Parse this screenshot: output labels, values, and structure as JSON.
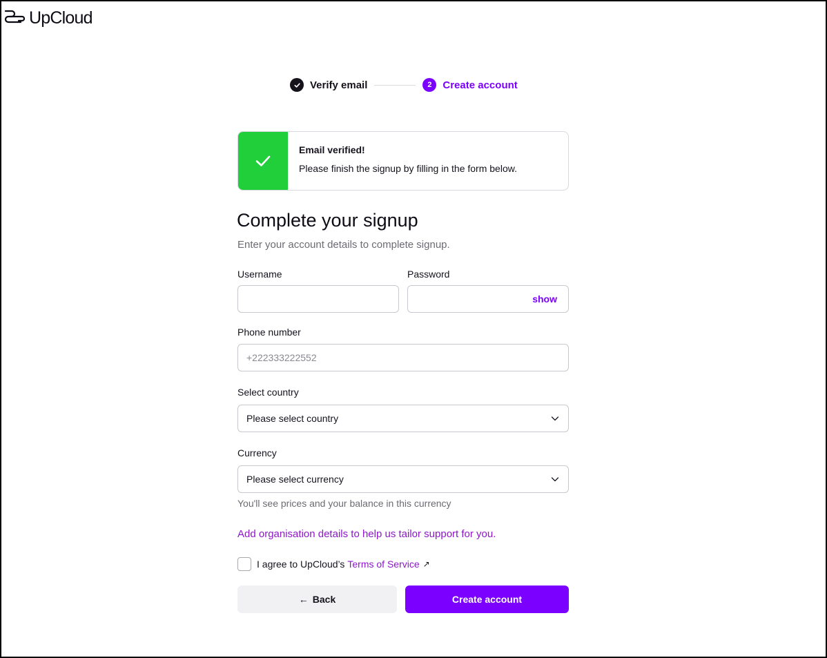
{
  "brand": {
    "name": "UpCloud",
    "accent": "#7b00ff",
    "success": "#21cf3a",
    "link": "#8d16c9"
  },
  "stepper": {
    "steps": [
      {
        "label": "Verify email",
        "status": "done",
        "icon": "check-icon"
      },
      {
        "label": "Create account",
        "status": "active",
        "number": "2"
      }
    ]
  },
  "alert": {
    "title": "Email verified!",
    "text": "Please finish the signup by filling in the form below.",
    "icon": "check-icon"
  },
  "form": {
    "title": "Complete your signup",
    "subtitle": "Enter your account details to complete signup.",
    "username": {
      "label": "Username",
      "value": "",
      "placeholder": ""
    },
    "password": {
      "label": "Password",
      "value": "",
      "placeholder": "",
      "toggle_label": "show"
    },
    "phone": {
      "label": "Phone number",
      "value": "",
      "placeholder": "+222333222552"
    },
    "country": {
      "label": "Select country",
      "selected": "Please select country",
      "icon": "chevron-down-icon"
    },
    "currency": {
      "label": "Currency",
      "selected": "Please select currency",
      "hint": "You'll see prices and your balance in this currency",
      "icon": "chevron-down-icon"
    },
    "org_link": "Add organisation details to help us tailor support for you.",
    "agree": {
      "text": "I agree to UpCloud’s",
      "tos_link": "Terms of Service",
      "ext_icon": "↗",
      "checked": false
    },
    "back_label": "Back",
    "back_icon": "←",
    "submit_label": "Create account"
  }
}
